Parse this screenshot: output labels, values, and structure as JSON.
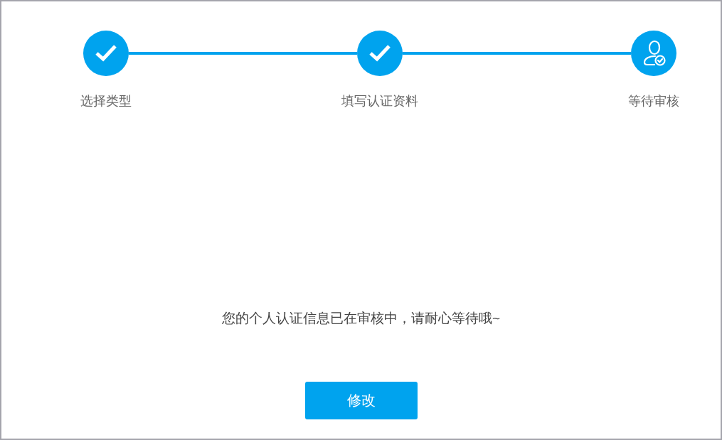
{
  "steps": [
    {
      "label": "选择类型",
      "completed": true
    },
    {
      "label": "填写认证资料",
      "completed": true
    },
    {
      "label": "等待审核",
      "completed": false
    }
  ],
  "message": "您的个人认证信息已在审核中，请耐心等待哦~",
  "button": "修改"
}
